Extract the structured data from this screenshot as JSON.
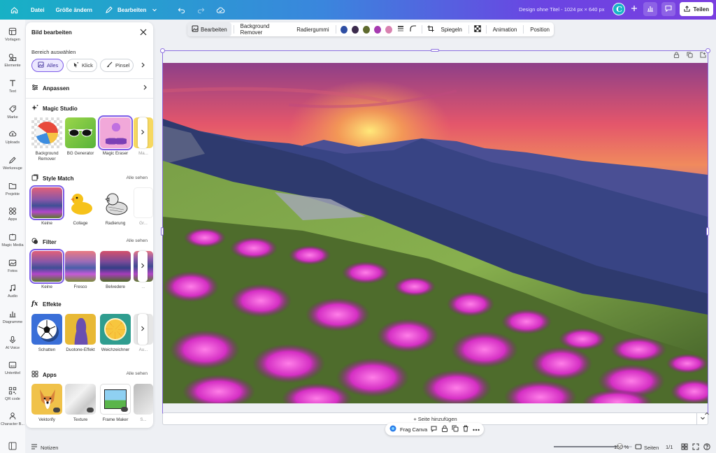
{
  "topbar": {
    "file": "Datei",
    "resize": "Größe ändern",
    "edit": "Bearbeiten",
    "doc_title": "Design ohne Titel - 1024 px × 640 px",
    "avatar_letter": "C",
    "share": "Teilen"
  },
  "rail": [
    {
      "label": "Vorlagen",
      "icon": "layout-icon"
    },
    {
      "label": "Elemente",
      "icon": "shapes-icon"
    },
    {
      "label": "Text",
      "icon": "text-icon"
    },
    {
      "label": "Marke",
      "icon": "brand-icon"
    },
    {
      "label": "Uploads",
      "icon": "upload-icon"
    },
    {
      "label": "Werkzeuge",
      "icon": "pen-icon"
    },
    {
      "label": "Projekte",
      "icon": "folder-icon"
    },
    {
      "label": "Apps",
      "icon": "apps-icon"
    },
    {
      "label": "Magic Media",
      "icon": "magic-icon"
    },
    {
      "label": "Fotos",
      "icon": "photo-icon"
    },
    {
      "label": "Audio",
      "icon": "music-icon"
    },
    {
      "label": "Diagramme",
      "icon": "chart-icon"
    },
    {
      "label": "AI Voice",
      "icon": "voice-icon"
    },
    {
      "label": "Untertitel",
      "icon": "subtitle-icon"
    },
    {
      "label": "QR code",
      "icon": "qr-icon"
    },
    {
      "label": "Character B...",
      "icon": "character-icon"
    }
  ],
  "panel": {
    "title": "Bild bearbeiten",
    "area_label": "Bereich auswählen",
    "chips": [
      "Alles",
      "Klick",
      "Pinsel"
    ],
    "adjust": "Anpassen",
    "magic_studio": {
      "title": "Magic Studio",
      "items": [
        "Background Remover",
        "BG Generator",
        "Magic Eraser",
        "Ma..."
      ]
    },
    "style_match": {
      "title": "Style Match",
      "see_all": "Alle sehen",
      "items": [
        "Keine",
        "Collage",
        "Radierung",
        "Gr..."
      ]
    },
    "filter": {
      "title": "Filter",
      "see_all": "Alle sehen",
      "items": [
        "Keine",
        "Fresco",
        "Belvedere",
        "..."
      ]
    },
    "effects": {
      "title": "Effekte",
      "items": [
        "Schatten",
        "Duotone-Effekt",
        "Weichzeichner",
        "Au..."
      ]
    },
    "apps": {
      "title": "Apps",
      "see_all": "Alle sehen",
      "items": [
        "Vektorify",
        "Texture",
        "Frame Maker",
        "S..."
      ]
    }
  },
  "toolbar": {
    "edit": "Bearbeiten",
    "bg_remover": "Background Remover",
    "eraser": "Radiergummi",
    "colors": [
      "#2e4ea3",
      "#3b2a4c",
      "#5f6a2e",
      "#a63ab0",
      "#d982b0"
    ],
    "flip": "Spiegeln",
    "animation": "Animation",
    "position": "Position"
  },
  "canvas": {
    "add_page": "+ Seite hinzufügen"
  },
  "floating": {
    "ask_canva": "Frag Canva"
  },
  "bottom": {
    "notes": "Notizen",
    "zoom_value": 150,
    "zoom": "150 %",
    "pages": "Seiten",
    "page_count": "1/1"
  }
}
